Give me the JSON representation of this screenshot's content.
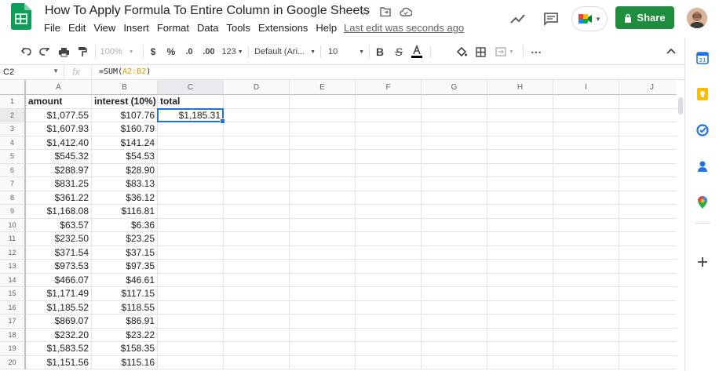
{
  "header": {
    "title": "How To Apply Formula To Entire Column in Google Sheets",
    "menu": [
      "File",
      "Edit",
      "View",
      "Insert",
      "Format",
      "Data",
      "Tools",
      "Extensions",
      "Help"
    ],
    "last_edit": "Last edit was seconds ago",
    "share_label": "Share",
    "icons": [
      "star-icon",
      "move-folder-icon",
      "cloud-status-icon",
      "trend-icon",
      "comment-icon",
      "meet-icon",
      "lock-icon"
    ]
  },
  "toolbar": {
    "zoom": "100%",
    "currency": "$",
    "percent": "%",
    "dec_less": ".0",
    "dec_more": ".00",
    "more_formats": "123",
    "font": "Default (Ari...",
    "font_size": "10",
    "bold": "B",
    "strike": "S",
    "text_color": "A",
    "more": "⋯"
  },
  "formula_bar": {
    "cell_ref": "C2",
    "fx": "fx",
    "formula_prefix": "=SUM(",
    "formula_ref": "A2:B2",
    "formula_suffix": ")"
  },
  "sheet": {
    "columns": [
      "A",
      "B",
      "C",
      "D",
      "E",
      "F",
      "G",
      "H",
      "I",
      "J"
    ],
    "selected_column": "C",
    "selected_row": 2,
    "headers": [
      "amount",
      "interest (10%)",
      "total"
    ],
    "rows": [
      {
        "n": "2",
        "a": "$1,077.55",
        "b": "$107.76",
        "c": "$1,185.31"
      },
      {
        "n": "3",
        "a": "$1,607.93",
        "b": "$160.79",
        "c": ""
      },
      {
        "n": "4",
        "a": "$1,412.40",
        "b": "$141.24",
        "c": ""
      },
      {
        "n": "5",
        "a": "$545.32",
        "b": "$54.53",
        "c": ""
      },
      {
        "n": "6",
        "a": "$288.97",
        "b": "$28.90",
        "c": ""
      },
      {
        "n": "7",
        "a": "$831.25",
        "b": "$83.13",
        "c": ""
      },
      {
        "n": "8",
        "a": "$361.22",
        "b": "$36.12",
        "c": ""
      },
      {
        "n": "9",
        "a": "$1,168.08",
        "b": "$116.81",
        "c": ""
      },
      {
        "n": "10",
        "a": "$63.57",
        "b": "$6.36",
        "c": ""
      },
      {
        "n": "11",
        "a": "$232.50",
        "b": "$23.25",
        "c": ""
      },
      {
        "n": "12",
        "a": "$371.54",
        "b": "$37.15",
        "c": ""
      },
      {
        "n": "13",
        "a": "$973.53",
        "b": "$97.35",
        "c": ""
      },
      {
        "n": "14",
        "a": "$466.07",
        "b": "$46.61",
        "c": ""
      },
      {
        "n": "15",
        "a": "$1,171.49",
        "b": "$117.15",
        "c": ""
      },
      {
        "n": "16",
        "a": "$1,185.52",
        "b": "$118.55",
        "c": ""
      },
      {
        "n": "17",
        "a": "$869.07",
        "b": "$86.91",
        "c": ""
      },
      {
        "n": "18",
        "a": "$232.20",
        "b": "$23.22",
        "c": ""
      },
      {
        "n": "19",
        "a": "$1,583.52",
        "b": "$158.35",
        "c": ""
      },
      {
        "n": "20",
        "a": "$1,151.56",
        "b": "$115.16",
        "c": ""
      }
    ]
  },
  "side_panel": [
    "calendar-icon",
    "keep-icon",
    "tasks-icon",
    "contacts-icon",
    "maps-icon",
    "add-icon"
  ],
  "colors": {
    "share_green": "#1e8e3e",
    "selection_blue": "#1a73e8",
    "formula_ref": "#f09300"
  }
}
